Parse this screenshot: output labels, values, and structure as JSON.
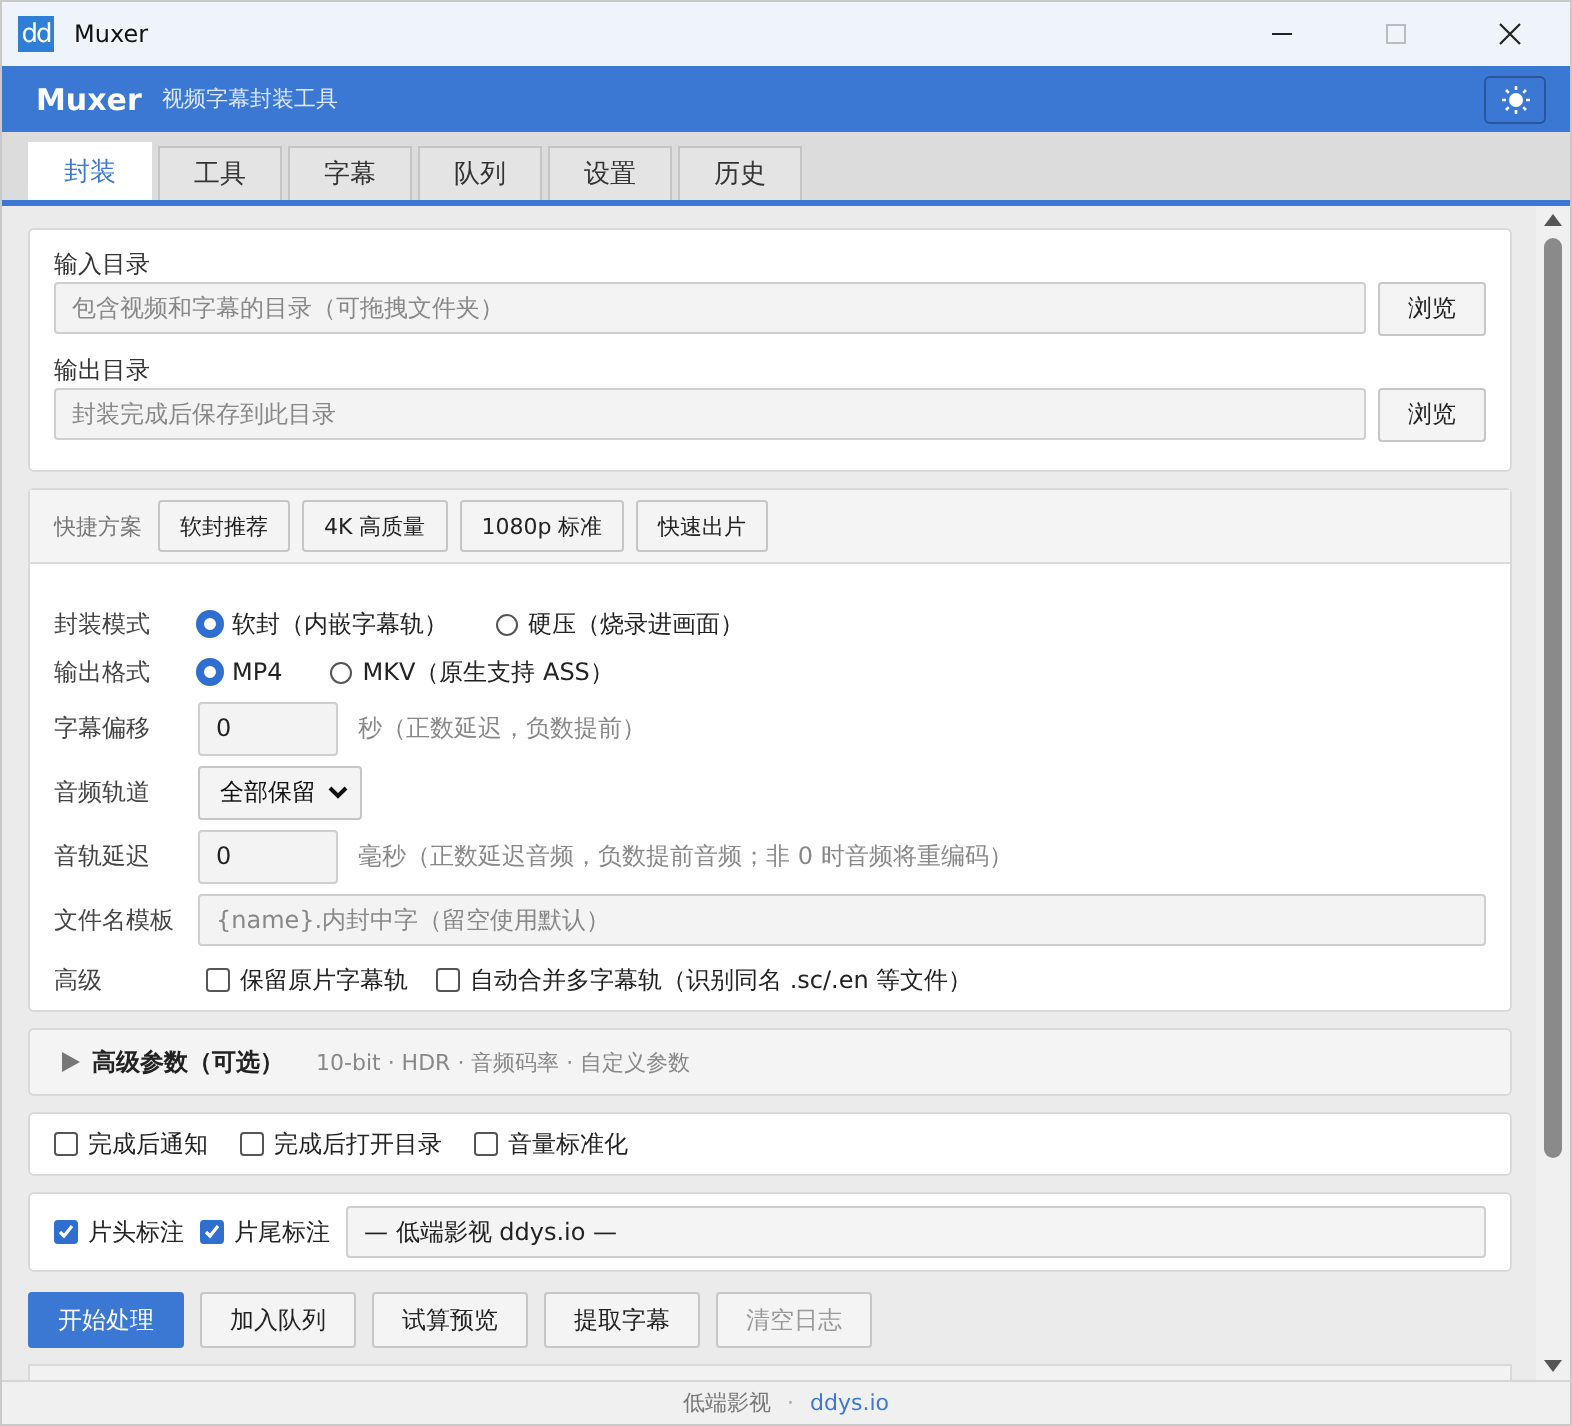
{
  "window": {
    "icon_text": "dd",
    "title": "Muxer"
  },
  "header": {
    "title": "Muxer",
    "subtitle": "视频字幕封装工具"
  },
  "tabs": [
    {
      "label": "封装",
      "selected": true
    },
    {
      "label": "工具",
      "selected": false
    },
    {
      "label": "字幕",
      "selected": false
    },
    {
      "label": "队列",
      "selected": false
    },
    {
      "label": "设置",
      "selected": false
    },
    {
      "label": "历史",
      "selected": false
    }
  ],
  "directories": [
    {
      "label": "输入目录",
      "placeholder": "包含视频和字幕的目录（可拖拽文件夹）",
      "button": "浏览"
    },
    {
      "label": "输出目录",
      "placeholder": "封装完成后保存到此目录",
      "button": "浏览"
    }
  ],
  "presets": {
    "label": "快捷方案",
    "buttons": [
      "软封推荐",
      "4K 高质量",
      "1080p 标准",
      "快速出片"
    ]
  },
  "form_rows": [
    {
      "kind": "radio",
      "label": "封装模式",
      "options": [
        {
          "label": "软封（内嵌字幕轨）",
          "selected": true
        },
        {
          "label": "硬压（烧录进画面）",
          "selected": false
        }
      ]
    },
    {
      "kind": "radio",
      "label": "输出格式",
      "options": [
        {
          "label": "MP4",
          "selected": true
        },
        {
          "label": "MKV（原生支持 ASS）",
          "selected": false
        }
      ]
    },
    {
      "kind": "number",
      "label": "字幕偏移",
      "value": "0",
      "hint": "秒（正数延迟，负数提前）"
    },
    {
      "kind": "select",
      "label": "音频轨道",
      "value": "全部保留"
    },
    {
      "kind": "number",
      "label": "音轨延迟",
      "value": "0",
      "hint": "毫秒（正数延迟音频，负数提前音频；非 0 时音频将重编码）"
    },
    {
      "kind": "text",
      "label": "文件名模板",
      "placeholder": "{name}.内封中字（留空使用默认）"
    },
    {
      "kind": "checks",
      "label": "高级",
      "options": [
        {
          "label": "保留原片字幕轨",
          "checked": false
        },
        {
          "label": "自动合并多字幕轨（识别同名 .sc/.en 等文件）",
          "checked": false
        }
      ]
    }
  ],
  "advanced": {
    "title": "高级参数（可选）",
    "summary": "10-bit · HDR · 音频码率 · 自定义参数",
    "expanded": false
  },
  "finish_options": [
    {
      "label": "完成后通知",
      "checked": false
    },
    {
      "label": "完成后打开目录",
      "checked": false
    },
    {
      "label": "音量标准化",
      "checked": false
    }
  ],
  "watermark_options": {
    "options": [
      {
        "label": "片头标注",
        "checked": true
      },
      {
        "label": "片尾标注",
        "checked": true
      }
    ],
    "value": "— 低端影视 ddys.io —"
  },
  "actions": [
    {
      "label": "开始处理",
      "primary": true,
      "disabled": false
    },
    {
      "label": "加入队列",
      "primary": false,
      "disabled": false
    },
    {
      "label": "试算预览",
      "primary": false,
      "disabled": false
    },
    {
      "label": "提取字幕",
      "primary": false,
      "disabled": false
    },
    {
      "label": "清空日志",
      "primary": false,
      "disabled": true
    }
  ],
  "footer": {
    "text": "低端影视",
    "separator": "·",
    "link": "ddys.io"
  }
}
